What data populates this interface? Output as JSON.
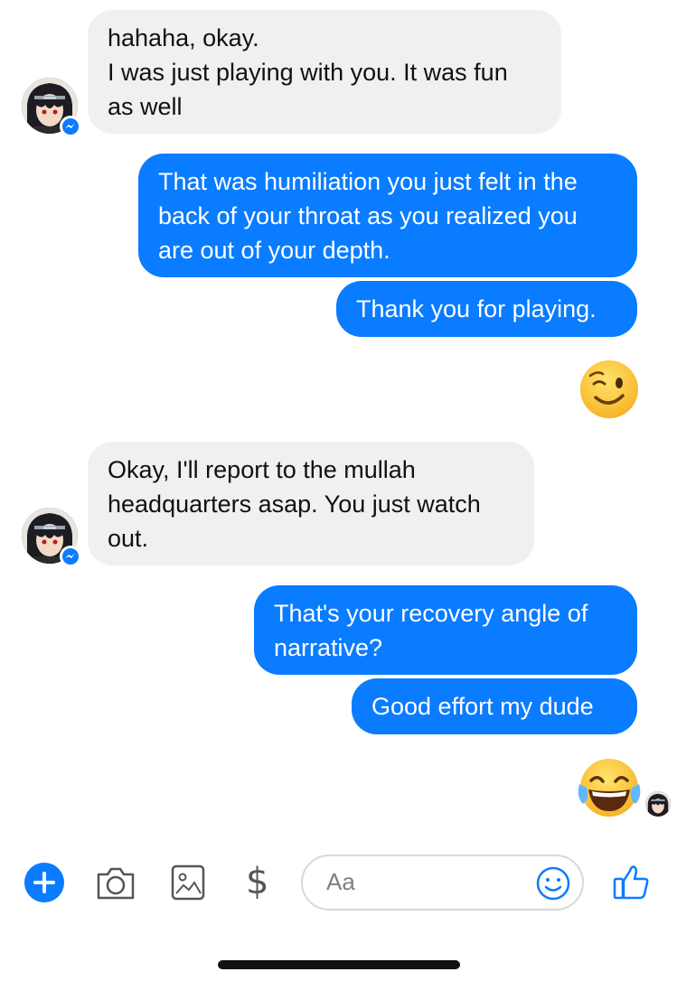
{
  "messages": [
    {
      "side": "in",
      "text": "hahaha, okay.\nI was just playing with you. It was fun\nas well"
    },
    {
      "side": "out",
      "text": "That was humiliation you just felt in the\nback of your throat as you realized you\nare out of your depth."
    },
    {
      "side": "out",
      "text": "Thank you for playing."
    },
    {
      "side": "out",
      "emoji": "winking-face"
    },
    {
      "side": "in",
      "text": "Okay, I'll report to the mullah\nheadquarters asap. You just watch\nout."
    },
    {
      "side": "out",
      "text": "That's your recovery angle of\nnarrative?"
    },
    {
      "side": "out",
      "text": "Good effort my dude"
    },
    {
      "side": "out",
      "emoji": "face-with-tears-of-joy"
    }
  ],
  "composer": {
    "placeholder": "Aa",
    "icons": [
      "plus-icon",
      "camera-icon",
      "gallery-icon",
      "dollar-icon",
      "emoji-icon",
      "like-icon"
    ],
    "dollar_glyph": "$"
  },
  "colors": {
    "accent": "#0a7cff",
    "incoming": "#f0f0f0"
  }
}
